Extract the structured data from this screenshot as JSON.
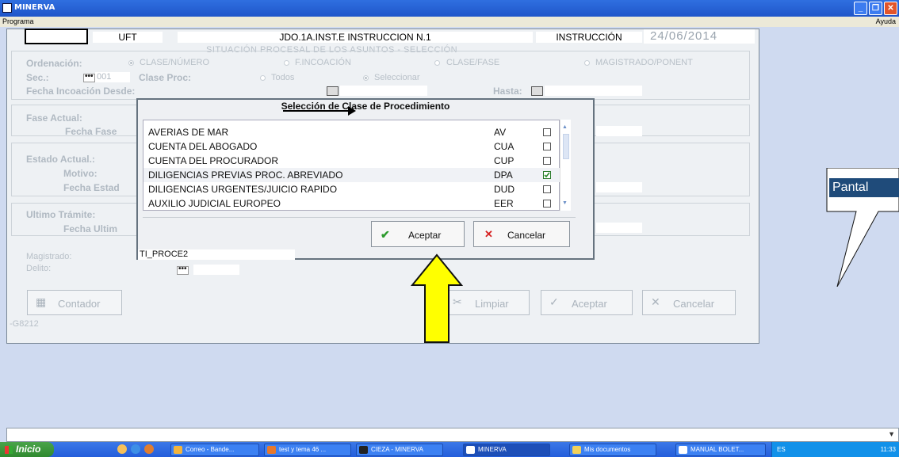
{
  "window": {
    "title": "MINERVA"
  },
  "menubar": {
    "left": "Programa",
    "right": "Ayuda"
  },
  "header": {
    "uft": "UFT",
    "court": "JDO.1A.INST.E INSTRUCCION N.1",
    "section": "INSTRUCCIÓN",
    "date": "24/06/2014",
    "subtitle": "SITUACIÓN PROCESAL DE LOS ASUNTOS - SELECCIÓN"
  },
  "form": {
    "ordenacion_label": "Ordenación:",
    "radio_clase_numero": "CLASE/NÚMERO",
    "radio_f_incoacion": "F.INCOACIÓN",
    "radio_clase_fase": "CLASE/FASE",
    "radio_magistrado": "MAGISTRADO/PONENT",
    "sec_label": "Sec.:",
    "sec_dots": "•••",
    "sec_value": "001",
    "clase_proc_label": "Clase Proc:",
    "radio_todos": "Todos",
    "radio_seleccionar": "Seleccionar",
    "fecha_incoacion_label": "Fecha Incoación Desde:",
    "hasta_label": "Hasta:",
    "fase_actual_label": "Fase Actual:",
    "fecha_fase_label": "Fecha Fase",
    "estado_actual_label": "Estado Actual.:",
    "motivo_label": "Motivo:",
    "fecha_estado_label": "Fecha Estad",
    "ultimo_tramite_label": "Ultimo Trámite:",
    "fecha_ultimo_label": "Fecha Ultim",
    "magistrado_label": "Magistrado:",
    "delito_label": "Delito:",
    "delito_dots": "•••",
    "contador_label": "Contador",
    "limpiar_label": "Limpiar",
    "aceptar_label": "Aceptar",
    "cancelar_label": "Cancelar",
    "footer_code": "-G8212"
  },
  "modal": {
    "title": "Selección de Clase de Procedimiento",
    "items": [
      {
        "name": "AVERIAS DE MAR",
        "code": "AV",
        "checked": false
      },
      {
        "name": "CUENTA DEL ABOGADO",
        "code": "CUA",
        "checked": false
      },
      {
        "name": "CUENTA DEL PROCURADOR",
        "code": "CUP",
        "checked": false
      },
      {
        "name": "DILIGENCIAS PREVIAS PROC. ABREVIADO",
        "code": "DPA",
        "checked": true
      },
      {
        "name": "DILIGENCIAS URGENTES/JUICIO RAPIDO",
        "code": "DUD",
        "checked": false
      },
      {
        "name": "AUXILIO JUDICIAL EUROPEO",
        "code": "EER",
        "checked": false
      }
    ],
    "ok_label": "Aceptar",
    "cancel_label": "Cancelar",
    "field_value": "TI_PROCE2"
  },
  "callout": {
    "text": "Pantal"
  },
  "taskbar": {
    "start_label": "Inicio",
    "tasks": [
      "Correo - Bande...",
      "test y tema 46 ...",
      "CIEZA - MINERVA",
      "MINERVA",
      "Mis documentos",
      "MANUAL BOLET..."
    ],
    "tray_lang": "ES",
    "clock": "11:33"
  }
}
